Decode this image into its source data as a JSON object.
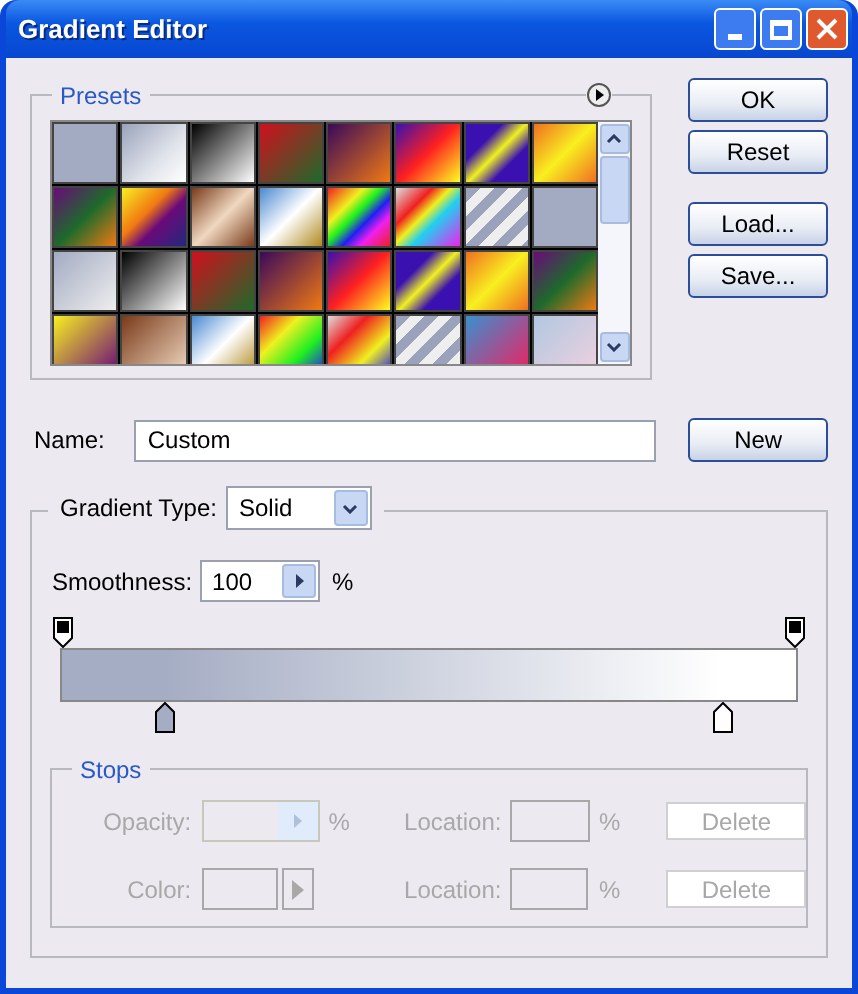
{
  "window": {
    "title": "Gradient Editor"
  },
  "presets": {
    "title": "Presets"
  },
  "buttons": [
    {
      "label": "OK"
    },
    {
      "label": "Reset"
    },
    {
      "label": "Load..."
    },
    {
      "label": "Save..."
    }
  ],
  "name": {
    "label": "Name:",
    "value": "Custom",
    "button": "New"
  },
  "gradient": {
    "type_label": "Gradient Type:",
    "type_value": "Solid",
    "smoothness_label": "Smoothness:",
    "smoothness_value": "100",
    "smoothness_unit": "%",
    "color_stops": [
      {
        "color": "#a5adc4"
      },
      {
        "color": "#ffffff"
      }
    ]
  },
  "stops": {
    "title": "Stops",
    "rows": [
      {
        "label": "Opacity:",
        "unit": "%",
        "location_label": "Location:",
        "location_unit": "%",
        "button": "Delete",
        "kind": "slider",
        "disabled": true
      },
      {
        "label": "Color:",
        "location_label": "Location:",
        "location_unit": "%",
        "button": "Delete",
        "kind": "color",
        "disabled": true
      }
    ]
  }
}
